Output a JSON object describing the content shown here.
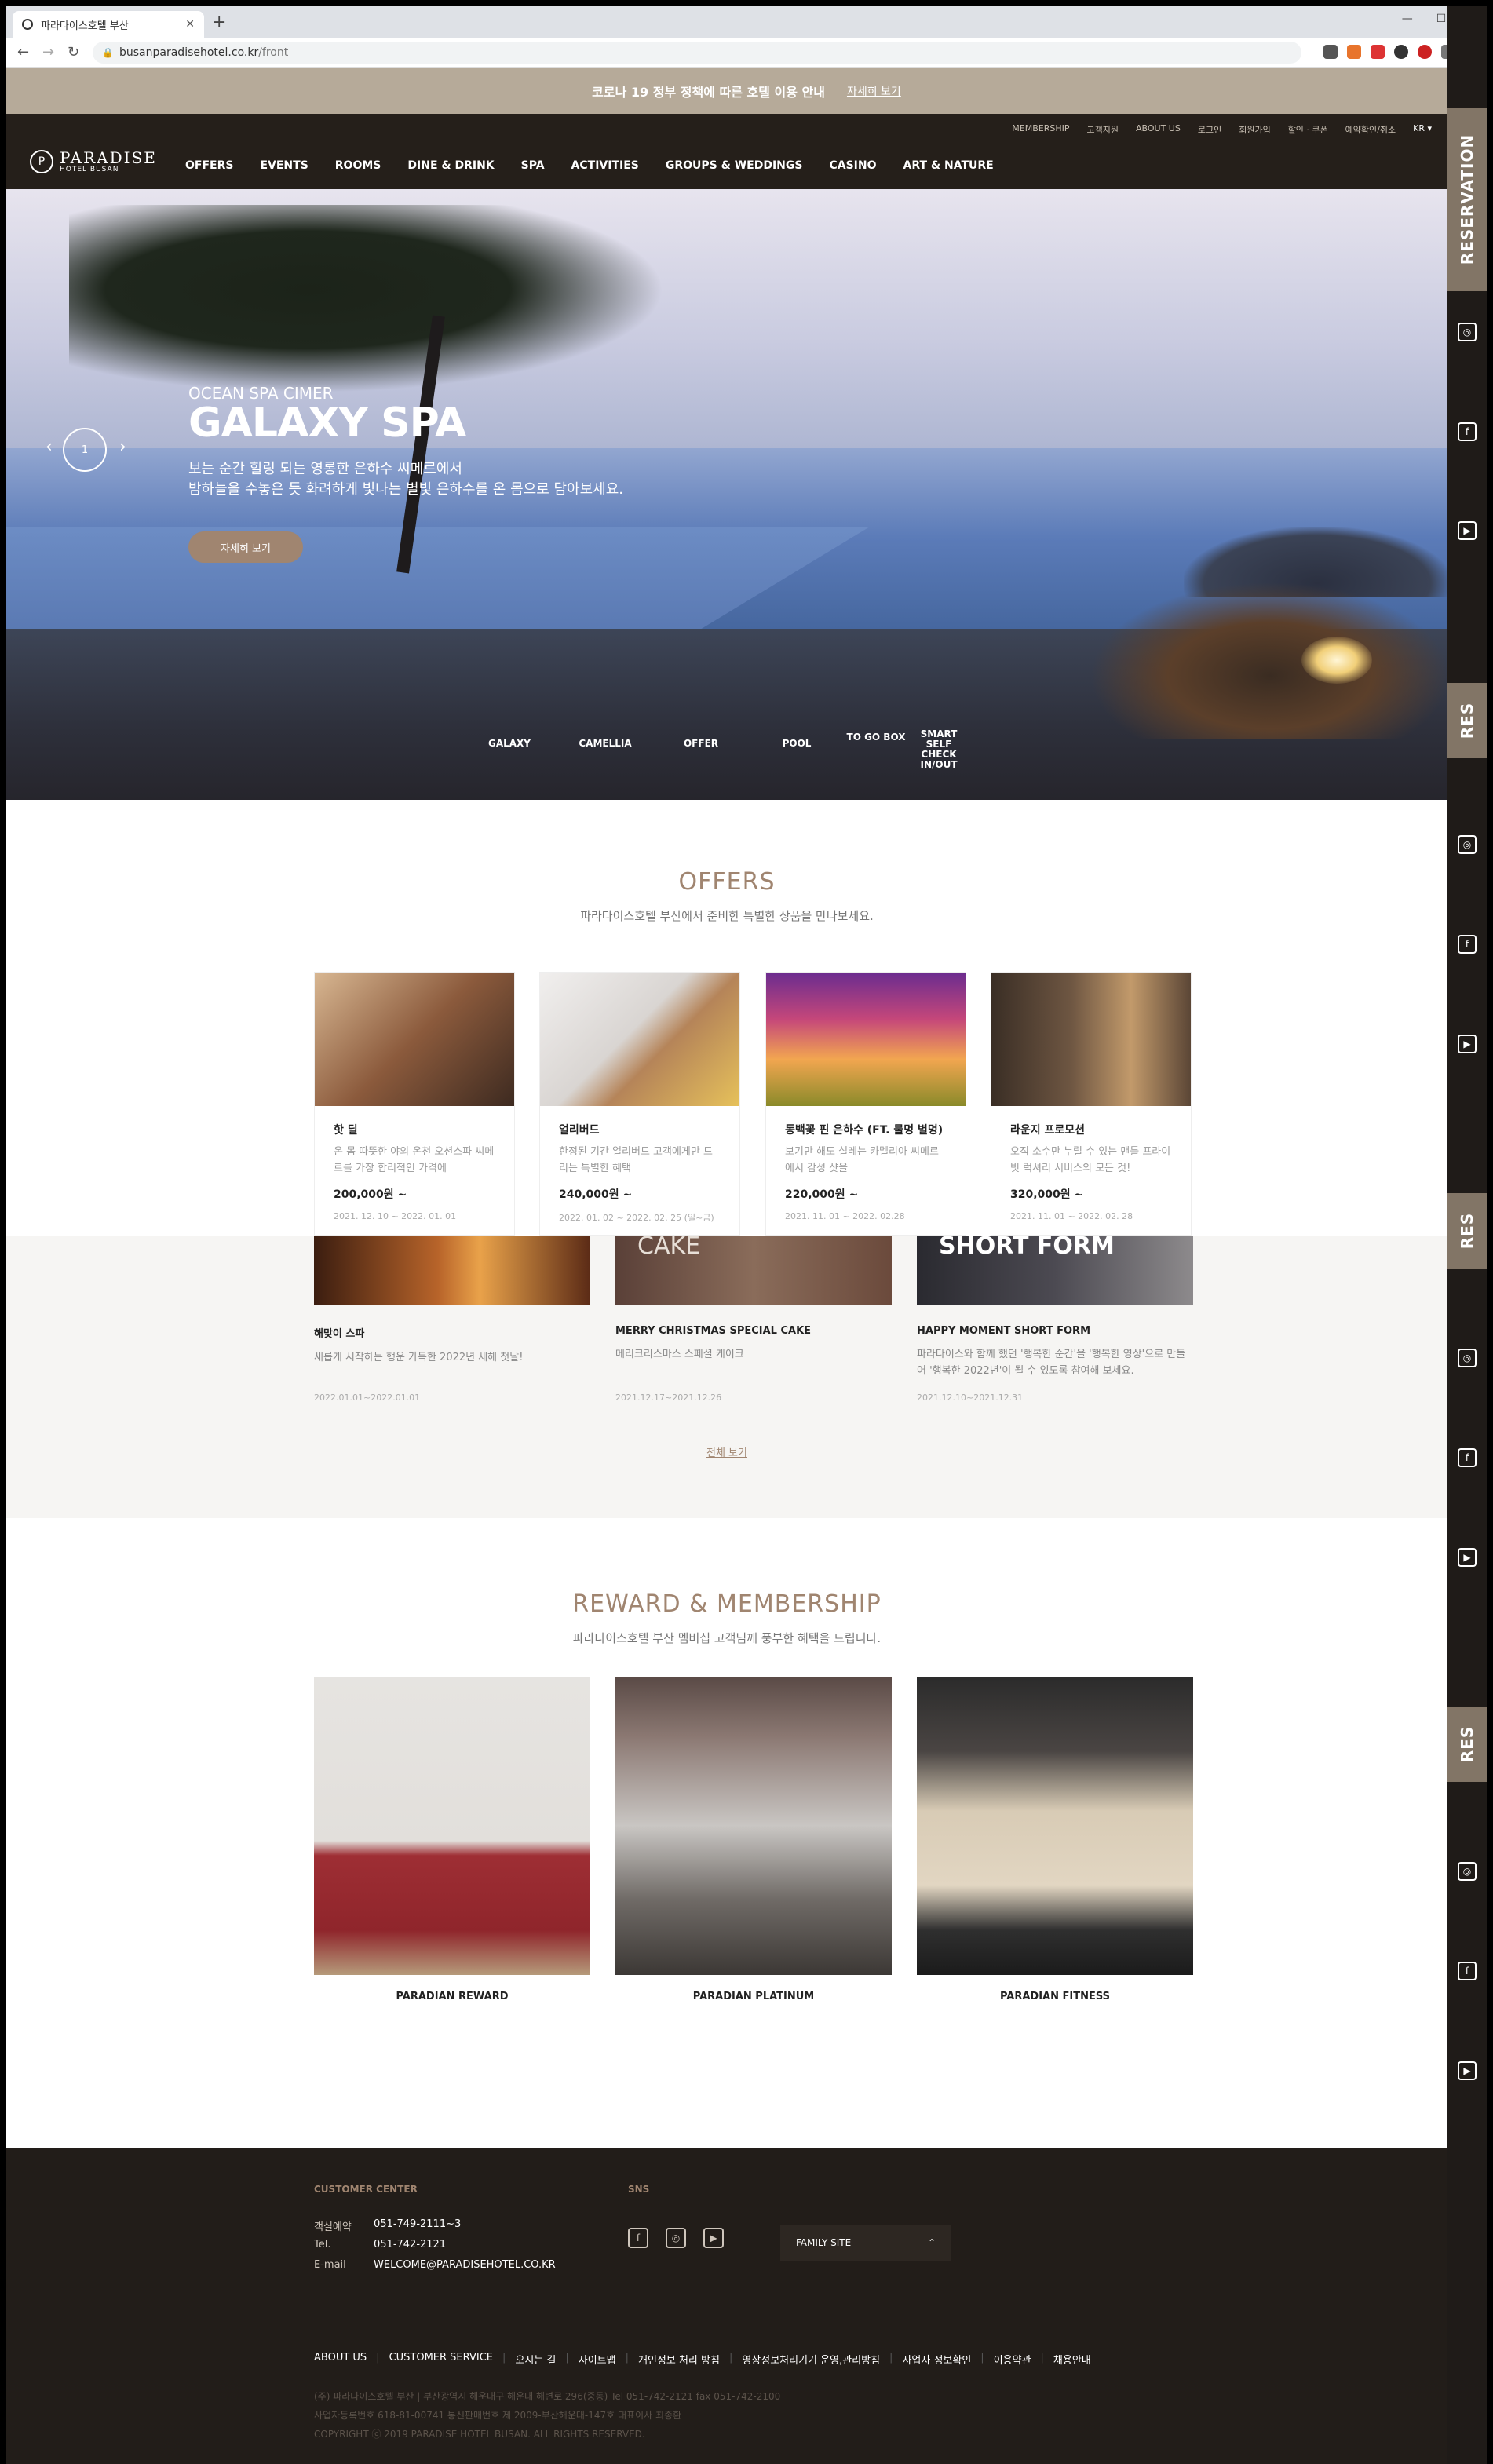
{
  "browser": {
    "tab_title": "파라다이스호텔 부산",
    "url_host": "busanparadisehotel.co.kr",
    "url_path": "/front"
  },
  "notice": {
    "text": "코로나 19 정부 정책에 따른 호텔 이용 안내",
    "link": "자세히 보기"
  },
  "utility_nav": [
    "MEMBERSHIP",
    "고객지원",
    "ABOUT US",
    "로그인",
    "회원가입",
    "할인 · 쿠폰",
    "예약확인/취소",
    "KR"
  ],
  "logo": {
    "name": "PARADISE",
    "sub": "HOTEL BUSAN"
  },
  "gnb": [
    "OFFERS",
    "EVENTS",
    "ROOMS",
    "DINE & DRINK",
    "SPA",
    "ACTIVITIES",
    "GROUPS & WEDDINGS",
    "CASINO",
    "ART & NATURE"
  ],
  "hero": {
    "subtitle": "OCEAN SPA CIMER",
    "title": "GALAXY SPA",
    "desc1": "보는 순간 힐링 되는 영롱한 은하수 씨메르에서",
    "desc2": "밤하늘을 수놓은 듯 화려하게 빛나는 별빛 은하수를 온 몸으로 담아보세요.",
    "button": "자세히 보기",
    "page": "1",
    "thumbs": [
      "GALAXY",
      "CAMELLIA",
      "OFFER",
      "POOL",
      "TO GO BOX",
      "SMART SELF CHECK IN/OUT"
    ]
  },
  "offers": {
    "title": "OFFERS",
    "subtitle": "파라다이스호텔 부산에서 준비한 특별한 상품을 만나보세요.",
    "cards": [
      {
        "title": "핫 딜",
        "desc": "온 몸 따뜻한 야외 온천 오션스파 씨메르를 가장 합리적인 가격에",
        "price": "200,000원 ~",
        "date": "2021. 12. 10 ~ 2022. 01. 01"
      },
      {
        "title": "얼리버드",
        "desc": "한정된 기간 얼리버드 고객에게만 드리는 특별한 혜택",
        "price": "240,000원 ~",
        "date": "2022. 01. 02 ~ 2022. 02. 25 (일~금)"
      },
      {
        "title": "동백꽃 핀 은하수 (FT. 물멍 별멍)",
        "desc": "보기만 해도 설레는 카멜리아 씨메르에서 감성 샷을",
        "price": "220,000원 ~",
        "date": "2021. 11. 01 ~ 2022. 02.28"
      },
      {
        "title": "라운지 프로모션",
        "desc": "오직 소수만 누릴 수 있는 맨틀 프라이빗 럭셔리 서비스의 모든 것!",
        "price": "320,000원 ~",
        "date": "2021. 11. 01 ~ 2022. 02. 28"
      }
    ]
  },
  "events": [
    {
      "title": "해맞이 스파",
      "desc": "새롭게 시작하는 행운 가득한 2022년 새해 첫날!",
      "date": "2022.01.01~2022.01.01",
      "overlay": ""
    },
    {
      "title": "MERRY CHRISTMAS SPECIAL CAKE",
      "desc": "메리크리스마스 스페셜 케이크",
      "date": "2021.12.17~2021.12.26",
      "overlay": "CAKE"
    },
    {
      "title": "HAPPY MOMENT SHORT FORM",
      "desc": "파라다이스와 함께 했던 '행복한 순간'을 '행복한 영상'으로 만들어 '행복한 2022년'이 될 수 있도록 참여해 보세요.",
      "date": "2021.12.10~2021.12.31",
      "overlay": "SHORT FORM"
    }
  ],
  "view_all": "전체 보기",
  "membership": {
    "title": "REWARD & MEMBERSHIP",
    "subtitle": "파라다이스호텔 부산 멤버십 고객님께 풍부한 혜택을 드립니다.",
    "items": [
      "PARADIAN REWARD",
      "PARADIAN PLATINUM",
      "PARADIAN FITNESS"
    ]
  },
  "sidebar": {
    "reservation": "RESERVATION",
    "reservation_short": "RES"
  },
  "footer": {
    "customer_center": "CUSTOMER CENTER",
    "rows": [
      {
        "label": "객실예약",
        "value": "051-749-2111~3"
      },
      {
        "label": "Tel.",
        "value": "051-742-2121"
      },
      {
        "label": "E-mail",
        "value": "WELCOME@PARADISEHOTEL.CO.KR"
      }
    ],
    "sns": "SNS",
    "family_site": "FAMILY SITE",
    "links": [
      "ABOUT US",
      "CUSTOMER SERVICE",
      "오시는 길",
      "사이트맵",
      "개인정보 처리 방침",
      "영상정보처리기기 운영,관리방침",
      "사업자 정보확인",
      "이용약관",
      "채용안내"
    ],
    "info1": "(주) 파라다이스호텔 부산 | 부산광역시 해운대구 해운대 해변로 296(중동) Tel 051-742-2121 fax 051-742-2100",
    "info2": "사업자등록번호 618-81-00741 통신판매번호 제 2009-부산해운대-147호 대표이사 최종환",
    "info3": "COPYRIGHT ⓒ 2019 PARADISE HOTEL BUSAN. ALL RIGHTS RESERVED."
  },
  "colors": {
    "accent": "#a08570",
    "header_bg": "#251f1a",
    "notice_bg": "#b6aa99",
    "reservation_bg": "#827566",
    "footer_bg": "#221d19"
  }
}
